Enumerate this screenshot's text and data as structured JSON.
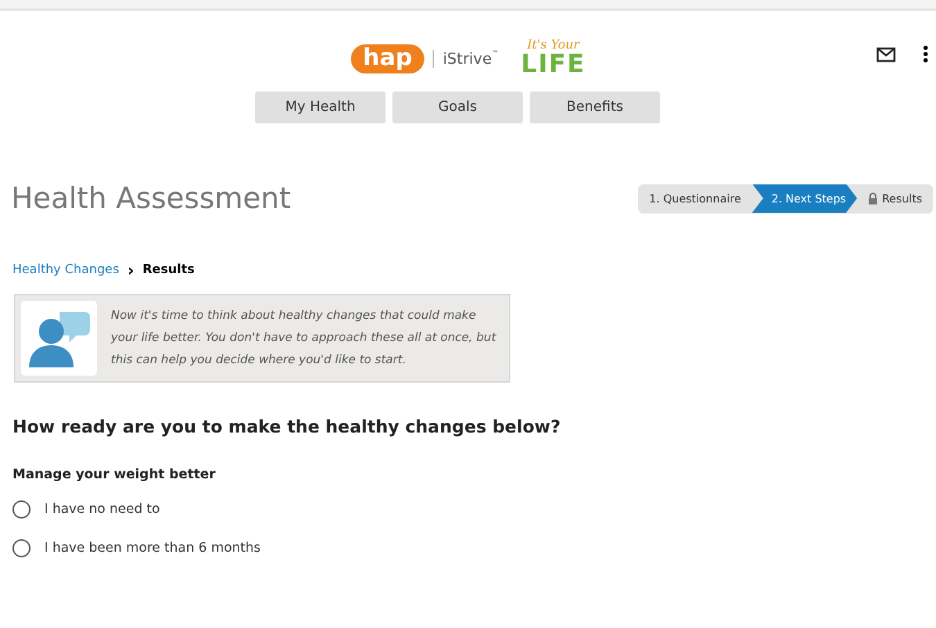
{
  "logo": {
    "brand": "hap",
    "product": "iStrive",
    "trademark": "™",
    "tagline": "It's Your",
    "tagline_big": "LIFE"
  },
  "nav": [
    {
      "label": "My Health"
    },
    {
      "label": "Goals"
    },
    {
      "label": "Benefits"
    }
  ],
  "page_title": "Health Assessment",
  "steps": [
    {
      "label": "1. Questionnaire",
      "selected": false,
      "locked": false
    },
    {
      "label": "2. Next Steps",
      "selected": true,
      "locked": false
    },
    {
      "label": "Results",
      "selected": false,
      "locked": true
    }
  ],
  "breadcrumb": {
    "link": "Healthy Changes",
    "separator": "›",
    "current": "Results"
  },
  "info": "Now it's time to think about healthy changes that could make your life better. You don't have to approach these all at once, but this can help you decide where you'd like to start.",
  "question": "How ready are you to make the healthy changes below?",
  "groups": [
    {
      "title": "Manage your weight better",
      "options": [
        {
          "label": "I have no need to",
          "selected": false
        },
        {
          "label": "I have been more than 6 months",
          "selected": false
        }
      ]
    }
  ]
}
